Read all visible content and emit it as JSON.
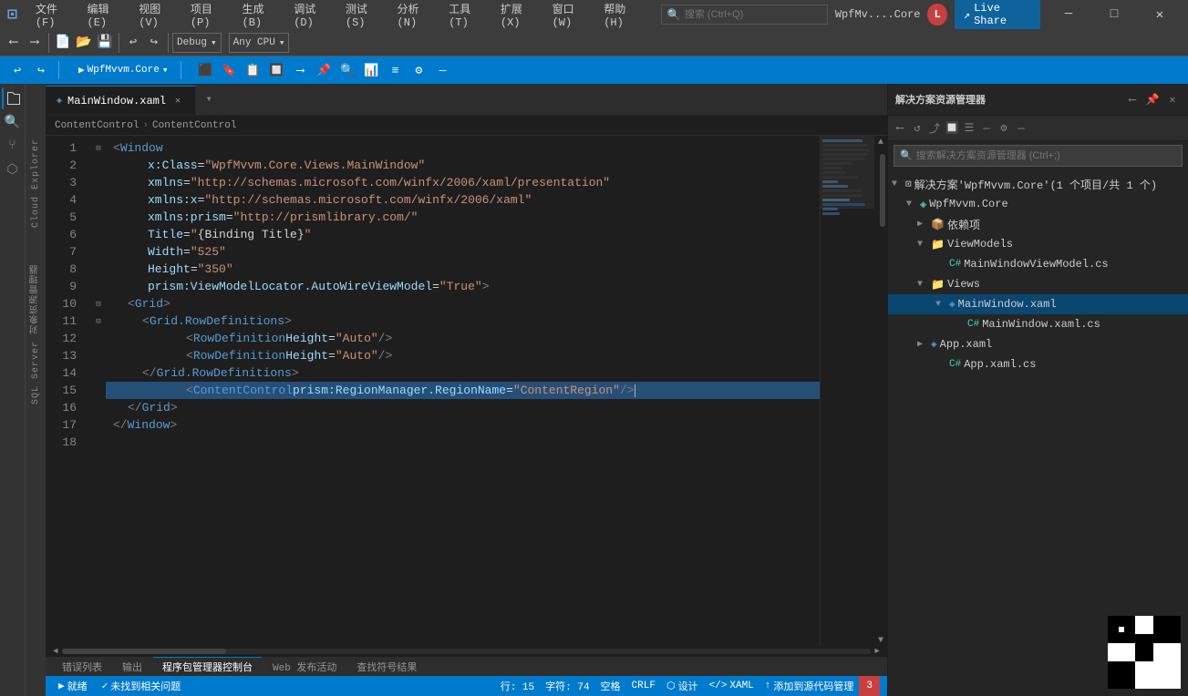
{
  "titlebar": {
    "logo": "⊡",
    "menus": [
      "文件(F)",
      "编辑(E)",
      "视图(V)",
      "项目(P)",
      "生成(B)",
      "调试(D)",
      "测试(S)",
      "分析(N)",
      "工具(T)",
      "扩展(X)",
      "窗口(W)",
      "帮助(H)"
    ],
    "search_placeholder": "搜索 (Ctrl+Q)",
    "title": "WpfMv....Core",
    "user_initial": "L",
    "live_share": "Live Share",
    "minimize": "─",
    "restore": "□",
    "close": "✕"
  },
  "toolbar": {
    "debug_mode": "Debug",
    "cpu": "Any CPU",
    "project": "WpfMvvm.Core",
    "back": "←",
    "forward": "→"
  },
  "tabs": {
    "active": "MainWindow.xaml",
    "active_dirty": false
  },
  "breadcrumb": {
    "part1": "ContentControl",
    "sep1": "›",
    "part2": "ContentControl"
  },
  "code": {
    "lines": [
      {
        "num": 1,
        "indent": 0,
        "fold": "─",
        "content": "<Window",
        "type": "tag-open"
      },
      {
        "num": 2,
        "indent": 1,
        "content": "x:Class=\"WpfMvvm.Core.Views.MainWindow\""
      },
      {
        "num": 3,
        "indent": 1,
        "content": "xmlns=\"http://schemas.microsoft.com/winfx/2006/xaml/presentation\""
      },
      {
        "num": 4,
        "indent": 1,
        "content": "xmlns:x=\"http://schemas.microsoft.com/winfx/2006/xaml\""
      },
      {
        "num": 5,
        "indent": 1,
        "content": "xmlns:prism=\"http://prismlibrary.com/\""
      },
      {
        "num": 6,
        "indent": 1,
        "content": "Title=\"{Binding Title}\""
      },
      {
        "num": 7,
        "indent": 1,
        "content": "Width=\"525\""
      },
      {
        "num": 8,
        "indent": 1,
        "content": "Height=\"350\""
      },
      {
        "num": 9,
        "indent": 1,
        "content": "prism:ViewModelLocator.AutoWireViewModel=\"True\">"
      },
      {
        "num": 10,
        "indent": 1,
        "fold": "─",
        "content": "<Grid>"
      },
      {
        "num": 11,
        "indent": 2,
        "fold": "─",
        "content": "<Grid.RowDefinitions>"
      },
      {
        "num": 12,
        "indent": 3,
        "content": "<RowDefinition Height=\"Auto\" />"
      },
      {
        "num": 13,
        "indent": 3,
        "content": "<RowDefinition Height=\"Auto\" />"
      },
      {
        "num": 14,
        "indent": 2,
        "content": "</Grid.RowDefinitions>"
      },
      {
        "num": 15,
        "indent": 3,
        "content": "<ContentControl prism:RegionManager.RegionName=\"ContentRegion\" />",
        "highlighted": true
      },
      {
        "num": 16,
        "indent": 1,
        "content": "</Grid>"
      },
      {
        "num": 17,
        "indent": 0,
        "content": "</Window>"
      },
      {
        "num": 18,
        "indent": 0,
        "content": ""
      }
    ]
  },
  "solution_explorer": {
    "title": "解决方案资源管理器",
    "search_placeholder": "搜索解决方案资源管理器 (Ctrl+;)",
    "tree": {
      "solution": "解决方案'WpfMvvm.Core'(1 个项目/共 1 个)",
      "project": "WpfMvvm.Core",
      "nodes": [
        {
          "label": "依赖项",
          "type": "folder",
          "level": 2,
          "expanded": false
        },
        {
          "label": "ViewModels",
          "type": "folder",
          "level": 2,
          "expanded": true
        },
        {
          "label": "MainWindowViewModel.cs",
          "type": "cs",
          "level": 3
        },
        {
          "label": "Views",
          "type": "folder",
          "level": 2,
          "expanded": true
        },
        {
          "label": "MainWindow.xaml",
          "type": "xaml",
          "level": 3,
          "selected": true
        },
        {
          "label": "MainWindow.xaml.cs",
          "type": "cs",
          "level": 4
        },
        {
          "label": "App.xaml",
          "type": "xaml",
          "level": 2,
          "expanded": false
        },
        {
          "label": "App.xaml.cs",
          "type": "cs",
          "level": 3
        }
      ]
    }
  },
  "status_bar": {
    "ready": "就绪",
    "no_issues": "未找到相关问题",
    "position": "行: 15",
    "char": "字符: 74",
    "spaces": "空格",
    "encoding": "CRLF",
    "design": "设计",
    "xaml": "XAML",
    "add_to_source": "添加到源代码管理"
  },
  "bottom_tabs": [
    "错误列表",
    "输出",
    "程序包管理器控制台",
    "Web 发布活动",
    "查找符号结果"
  ],
  "icons": {
    "search": "🔍",
    "folder_open": "📂",
    "folder_closed": "📁",
    "file_xaml": "📄",
    "file_cs": "📄",
    "arrow_right": "▶",
    "arrow_down": "▼",
    "expand": "▷",
    "live_share_icon": "↗",
    "play": "▶",
    "gear": "⚙"
  }
}
